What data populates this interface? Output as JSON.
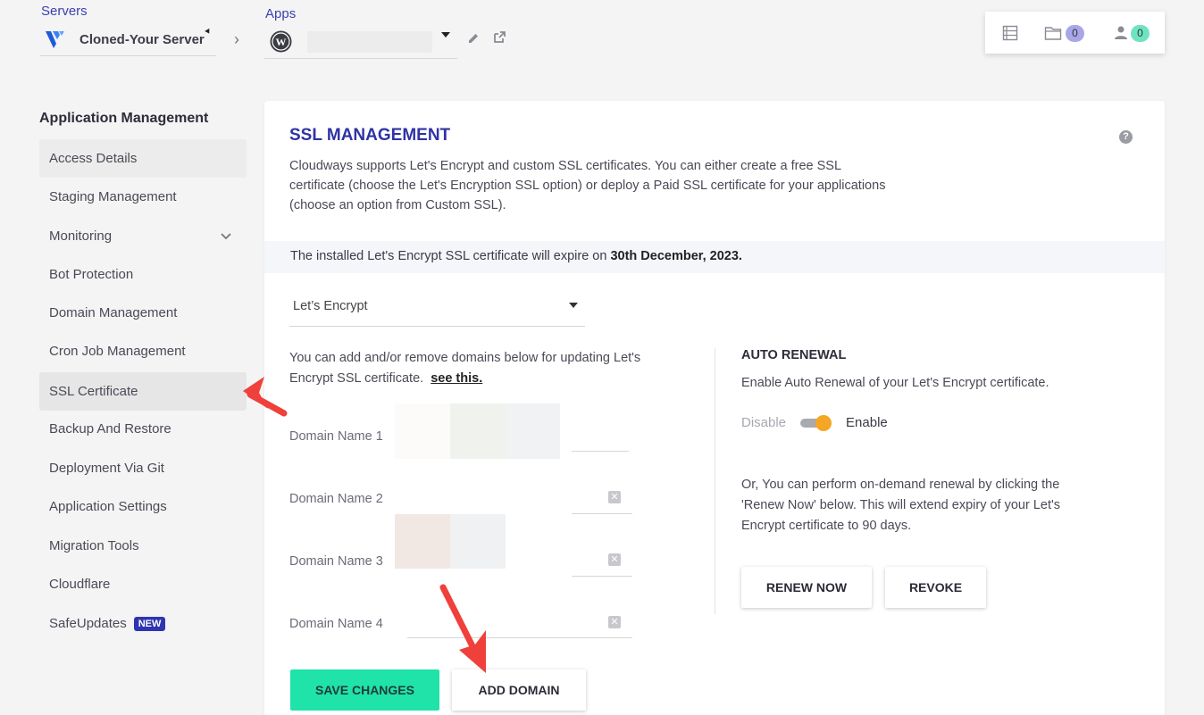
{
  "topbar": {
    "servers_label": "Servers",
    "server_name": "Cloned-Your Server",
    "apps_label": "Apps",
    "files_count": "0",
    "members_count": "0"
  },
  "sidebar": {
    "title": "Application Management",
    "items": [
      {
        "label": "Access Details"
      },
      {
        "label": "Staging Management"
      },
      {
        "label": "Monitoring"
      },
      {
        "label": "Bot Protection"
      },
      {
        "label": "Domain Management"
      },
      {
        "label": "Cron Job Management"
      },
      {
        "label": "SSL Certificate"
      },
      {
        "label": "Backup And Restore"
      },
      {
        "label": "Deployment Via Git"
      },
      {
        "label": "Application Settings"
      },
      {
        "label": "Migration Tools"
      },
      {
        "label": "Cloudflare"
      },
      {
        "label": "SafeUpdates",
        "badge": "NEW"
      }
    ]
  },
  "ssl": {
    "title": "SSL MANAGEMENT",
    "description": "Cloudways supports Let's Encrypt and custom SSL certificates. You can either create a free SSL certificate (choose the Let's Encryption SSL option) or deploy a Paid SSL certificate for your applications (choose an option from Custom SSL).",
    "expiry_prefix": "The installed Let's Encrypt SSL certificate will expire on ",
    "expiry_date": "30th December, 2023.",
    "type_selected": "Let’s Encrypt",
    "domains_text": "You can add and/or remove domains below for updating Let's Encrypt SSL certificate.",
    "see_this": "see this.",
    "domain_labels": [
      "Domain Name 1",
      "Domain Name 2",
      "Domain Name 3",
      "Domain Name 4"
    ],
    "save_button": "SAVE CHANGES",
    "add_domain_button": "ADD DOMAIN"
  },
  "auto_renewal": {
    "title": "AUTO RENEWAL",
    "description": "Enable Auto Renewal of your Let's Encrypt certificate.",
    "disable_label": "Disable",
    "enable_label": "Enable",
    "enabled": true,
    "renew_text": "Or, You can perform on-demand renewal by clicking the 'Renew Now' below. This will extend expiry of your Let's Encrypt certificate to 90 days.",
    "renew_button": "RENEW NOW",
    "revoke_button": "REVOKE"
  },
  "colors": {
    "accent": "#2e33a6",
    "save_green": "#1fe3a8",
    "toggle_on": "#f5a623",
    "annotation_arrow": "#f0403c"
  }
}
